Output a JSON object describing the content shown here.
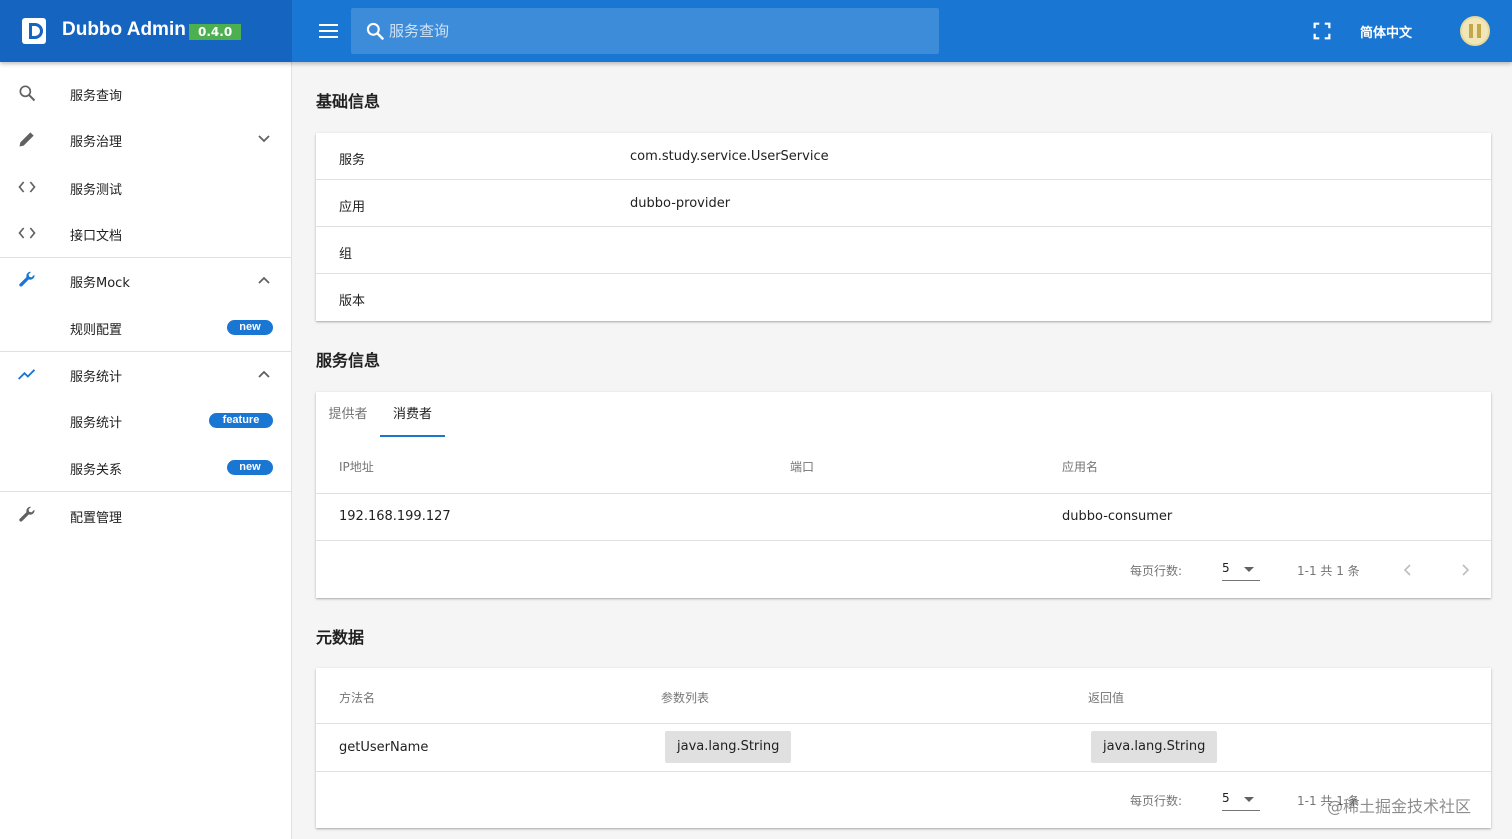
{
  "header": {
    "app_title": "Dubbo Admin",
    "version": "0.4.0",
    "search_placeholder": "服务查询",
    "language": "简体中文",
    "colors": {
      "primary": "#1976d2",
      "brand_bg": "#1565c0",
      "version_badge": "#4caf50"
    }
  },
  "sidebar": {
    "items": [
      {
        "label": "服务查询",
        "icon": "search-icon"
      },
      {
        "label": "服务治理",
        "icon": "pencil-icon",
        "expand": "chevron-down-icon"
      },
      {
        "label": "服务测试",
        "icon": "code-icon"
      },
      {
        "label": "接口文档",
        "icon": "code-icon"
      },
      {
        "label": "服务Mock",
        "icon": "wrench-icon",
        "expand": "chevron-up-icon"
      },
      {
        "label": "规则配置",
        "badge": "new"
      },
      {
        "label": "服务统计",
        "icon": "trending-up-icon",
        "expand": "chevron-up-icon"
      },
      {
        "label": "服务统计",
        "badge": "feature"
      },
      {
        "label": "服务关系",
        "badge": "new"
      },
      {
        "label": "配置管理",
        "icon": "wrench-icon"
      }
    ]
  },
  "basic_info": {
    "title": "基础信息",
    "rows": [
      {
        "key": "服务",
        "value": "com.study.service.UserService"
      },
      {
        "key": "应用",
        "value": "dubbo-provider"
      },
      {
        "key": "组",
        "value": ""
      },
      {
        "key": "版本",
        "value": ""
      }
    ]
  },
  "service_info": {
    "title": "服务信息",
    "tabs": [
      {
        "label": "提供者"
      },
      {
        "label": "消费者",
        "active": true
      }
    ],
    "headers": [
      "IP地址",
      "端口",
      "应用名"
    ],
    "rows": [
      {
        "ip": "192.168.199.127",
        "port": "",
        "app": "dubbo-consumer"
      }
    ],
    "footer": {
      "rows_per_page_label": "每页行数:",
      "rows_per_page": "5",
      "range": "1-1 共 1 条"
    }
  },
  "metadata": {
    "title": "元数据",
    "headers": [
      "方法名",
      "参数列表",
      "返回值"
    ],
    "rows": [
      {
        "method": "getUserName",
        "params": "java.lang.String",
        "return": "java.lang.String"
      }
    ],
    "footer": {
      "rows_per_page_label": "每页行数:",
      "rows_per_page": "5",
      "range": "1-1 共 1 条"
    }
  },
  "watermark": "@稀土掘金技术社区"
}
